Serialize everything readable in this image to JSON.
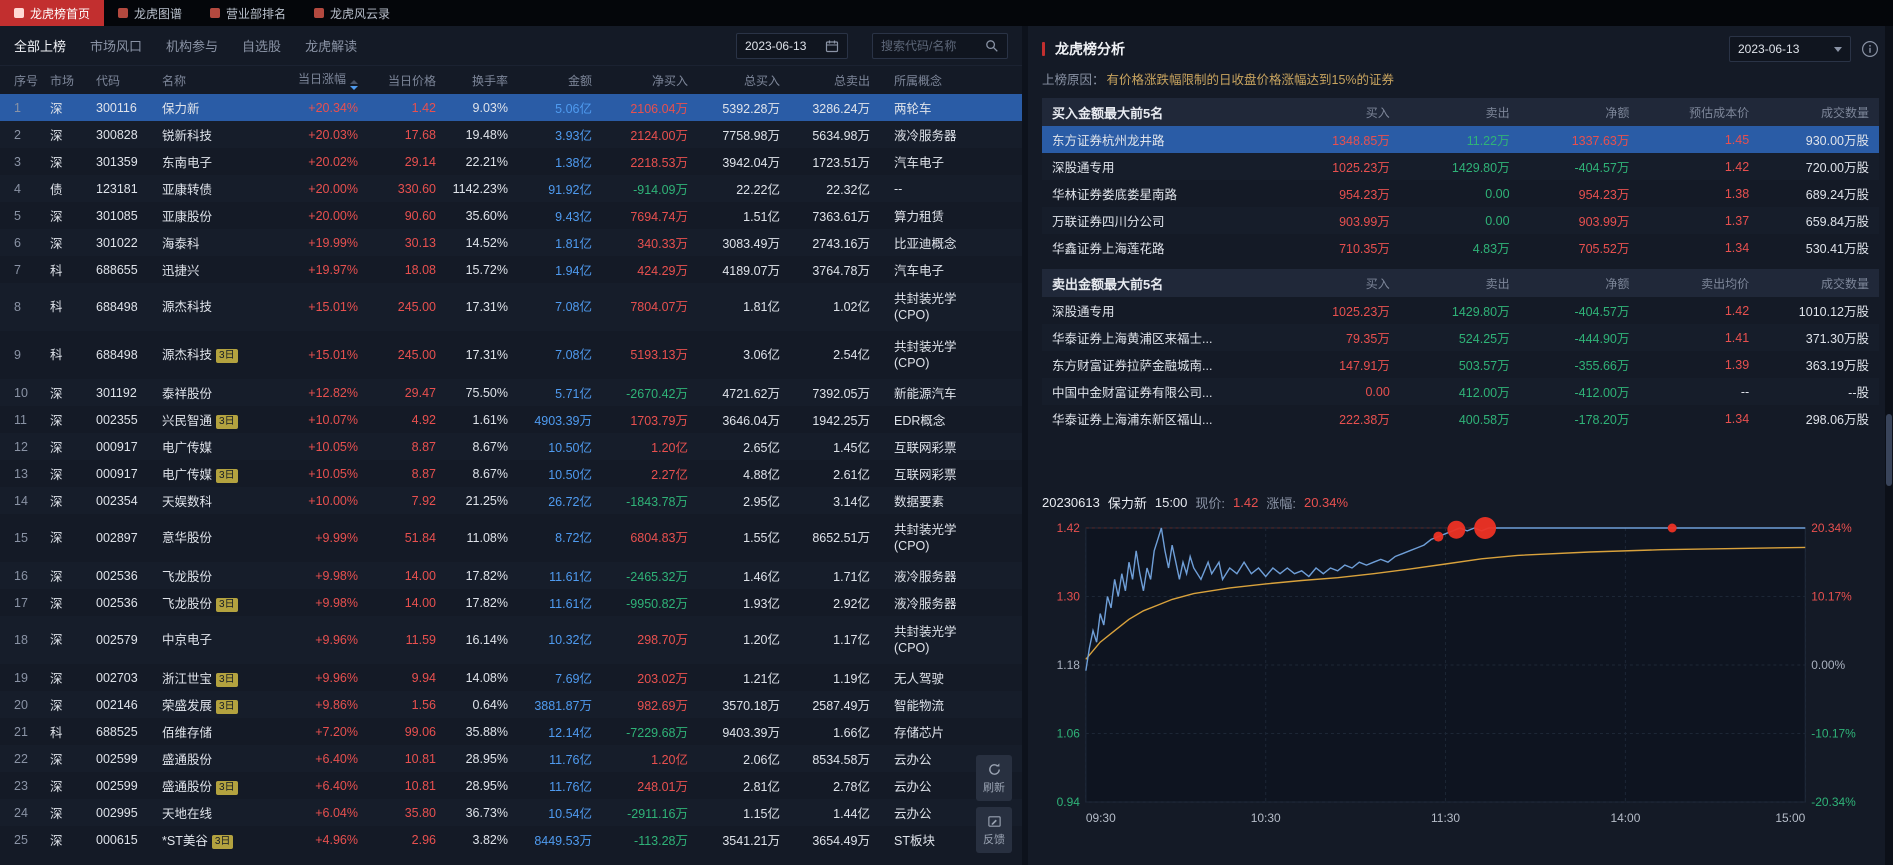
{
  "colors": {
    "accent": "#c22f2f",
    "up": "#e8504f",
    "down": "#2fb378",
    "blue": "#4f9bf0",
    "sel": "#2a5ca6",
    "badge": "#b3a23f",
    "reason": "#c8a45f",
    "price_line": "#6f9fd8",
    "avg_line": "#d9a23c",
    "marker": "#ee3124"
  },
  "topbar": {
    "tabs": [
      {
        "id": "home",
        "label": "龙虎榜首页",
        "active": true
      },
      {
        "id": "map",
        "label": "龙虎图谱",
        "active": false
      },
      {
        "id": "broker-rank",
        "label": "营业部排名",
        "active": false
      },
      {
        "id": "chronicle",
        "label": "龙虎风云录",
        "active": false
      }
    ]
  },
  "left": {
    "tabs": [
      {
        "id": "all",
        "label": "全部上榜",
        "active": true
      },
      {
        "id": "market-wind",
        "label": "市场风口",
        "active": false
      },
      {
        "id": "institution",
        "label": "机构参与",
        "active": false
      },
      {
        "id": "watchlist",
        "label": "自选股",
        "active": false
      },
      {
        "id": "interpretation",
        "label": "龙虎解读",
        "active": false
      }
    ],
    "date": "2023-06-13",
    "search_placeholder": "搜索代码/名称",
    "refresh_label": "刷新",
    "feedback_label": "反馈",
    "columns": [
      "序号",
      "市场",
      "代码",
      "名称",
      "当日涨幅",
      "当日价格",
      "换手率",
      "金额",
      "净买入",
      "总买入",
      "总卖出",
      "所属概念"
    ],
    "rows": [
      {
        "seq": "1",
        "market": "深",
        "code": "300116",
        "name": "保力新",
        "chg": "+20.34%",
        "price": "1.42",
        "to": "9.03%",
        "amt": "5.06亿",
        "net": "2106.04万",
        "tbuy": "5392.28万",
        "tsell": "3286.24万",
        "concept": [
          "两轮车"
        ],
        "sel": true
      },
      {
        "seq": "2",
        "market": "深",
        "code": "300828",
        "name": "锐新科技",
        "chg": "+20.03%",
        "price": "17.68",
        "to": "19.48%",
        "amt": "3.93亿",
        "net": "2124.00万",
        "tbuy": "7758.98万",
        "tsell": "5634.98万",
        "concept": [
          "液冷服务器"
        ]
      },
      {
        "seq": "3",
        "market": "深",
        "code": "301359",
        "name": "东南电子",
        "chg": "+20.02%",
        "price": "29.14",
        "to": "22.21%",
        "amt": "1.38亿",
        "net": "2218.53万",
        "tbuy": "3942.04万",
        "tsell": "1723.51万",
        "concept": [
          "汽车电子"
        ]
      },
      {
        "seq": "4",
        "market": "债",
        "code": "123181",
        "name": "亚康转债",
        "chg": "+20.00%",
        "price": "330.60",
        "to": "1142.23%",
        "amt": "91.92亿",
        "net": "-914.09万",
        "tbuy": "22.22亿",
        "tsell": "22.32亿",
        "concept": [
          "--"
        ]
      },
      {
        "seq": "5",
        "market": "深",
        "code": "301085",
        "name": "亚康股份",
        "chg": "+20.00%",
        "price": "90.60",
        "to": "35.60%",
        "amt": "9.43亿",
        "net": "7694.74万",
        "tbuy": "1.51亿",
        "tsell": "7363.61万",
        "concept": [
          "算力租赁"
        ]
      },
      {
        "seq": "6",
        "market": "深",
        "code": "301022",
        "name": "海泰科",
        "chg": "+19.99%",
        "price": "30.13",
        "to": "14.52%",
        "amt": "1.81亿",
        "net": "340.33万",
        "tbuy": "3083.49万",
        "tsell": "2743.16万",
        "concept": [
          "比亚迪概念"
        ]
      },
      {
        "seq": "7",
        "market": "科",
        "code": "688655",
        "name": "迅捷兴",
        "chg": "+19.97%",
        "price": "18.08",
        "to": "15.72%",
        "amt": "1.94亿",
        "net": "424.29万",
        "tbuy": "4189.07万",
        "tsell": "3764.78万",
        "concept": [
          "汽车电子"
        ]
      },
      {
        "seq": "8",
        "market": "科",
        "code": "688498",
        "name": "源杰科技",
        "chg": "+15.01%",
        "price": "245.00",
        "to": "17.31%",
        "amt": "7.08亿",
        "net": "7804.07万",
        "tbuy": "1.81亿",
        "tsell": "1.02亿",
        "concept": [
          "共封装光学",
          "(CPO)"
        ]
      },
      {
        "seq": "9",
        "market": "科",
        "code": "688498",
        "name": "源杰科技",
        "badge": "3日",
        "chg": "+15.01%",
        "price": "245.00",
        "to": "17.31%",
        "amt": "7.08亿",
        "net": "5193.13万",
        "tbuy": "3.06亿",
        "tsell": "2.54亿",
        "concept": [
          "共封装光学",
          "(CPO)"
        ]
      },
      {
        "seq": "10",
        "market": "深",
        "code": "301192",
        "name": "泰祥股份",
        "chg": "+12.82%",
        "price": "29.47",
        "to": "75.50%",
        "amt": "5.71亿",
        "net": "-2670.42万",
        "tbuy": "4721.62万",
        "tsell": "7392.05万",
        "concept": [
          "新能源汽车"
        ]
      },
      {
        "seq": "11",
        "market": "深",
        "code": "002355",
        "name": "兴民智通",
        "badge": "3日",
        "chg": "+10.07%",
        "price": "4.92",
        "to": "1.61%",
        "amt": "4903.39万",
        "net": "1703.79万",
        "tbuy": "3646.04万",
        "tsell": "1942.25万",
        "concept": [
          "EDR概念"
        ]
      },
      {
        "seq": "12",
        "market": "深",
        "code": "000917",
        "name": "电广传媒",
        "chg": "+10.05%",
        "price": "8.87",
        "to": "8.67%",
        "amt": "10.50亿",
        "net": "1.20亿",
        "tbuy": "2.65亿",
        "tsell": "1.45亿",
        "concept": [
          "互联网彩票"
        ]
      },
      {
        "seq": "13",
        "market": "深",
        "code": "000917",
        "name": "电广传媒",
        "badge": "3日",
        "chg": "+10.05%",
        "price": "8.87",
        "to": "8.67%",
        "amt": "10.50亿",
        "net": "2.27亿",
        "tbuy": "4.88亿",
        "tsell": "2.61亿",
        "concept": [
          "互联网彩票"
        ]
      },
      {
        "seq": "14",
        "market": "深",
        "code": "002354",
        "name": "天娱数科",
        "chg": "+10.00%",
        "price": "7.92",
        "to": "21.25%",
        "amt": "26.72亿",
        "net": "-1843.78万",
        "tbuy": "2.95亿",
        "tsell": "3.14亿",
        "concept": [
          "数据要素"
        ]
      },
      {
        "seq": "15",
        "market": "深",
        "code": "002897",
        "name": "意华股份",
        "chg": "+9.99%",
        "price": "51.84",
        "to": "11.08%",
        "amt": "8.72亿",
        "net": "6804.83万",
        "tbuy": "1.55亿",
        "tsell": "8652.51万",
        "concept": [
          "共封装光学",
          "(CPO)"
        ]
      },
      {
        "seq": "16",
        "market": "深",
        "code": "002536",
        "name": "飞龙股份",
        "chg": "+9.98%",
        "price": "14.00",
        "to": "17.82%",
        "amt": "11.61亿",
        "net": "-2465.32万",
        "tbuy": "1.46亿",
        "tsell": "1.71亿",
        "concept": [
          "液冷服务器"
        ]
      },
      {
        "seq": "17",
        "market": "深",
        "code": "002536",
        "name": "飞龙股份",
        "badge": "3日",
        "chg": "+9.98%",
        "price": "14.00",
        "to": "17.82%",
        "amt": "11.61亿",
        "net": "-9950.82万",
        "tbuy": "1.93亿",
        "tsell": "2.92亿",
        "concept": [
          "液冷服务器"
        ]
      },
      {
        "seq": "18",
        "market": "深",
        "code": "002579",
        "name": "中京电子",
        "chg": "+9.96%",
        "price": "11.59",
        "to": "16.14%",
        "amt": "10.32亿",
        "net": "298.70万",
        "tbuy": "1.20亿",
        "tsell": "1.17亿",
        "concept": [
          "共封装光学",
          "(CPO)"
        ]
      },
      {
        "seq": "19",
        "market": "深",
        "code": "002703",
        "name": "浙江世宝",
        "badge": "3日",
        "chg": "+9.96%",
        "price": "9.94",
        "to": "14.08%",
        "amt": "7.69亿",
        "net": "203.02万",
        "tbuy": "1.21亿",
        "tsell": "1.19亿",
        "concept": [
          "无人驾驶"
        ]
      },
      {
        "seq": "20",
        "market": "深",
        "code": "002146",
        "name": "荣盛发展",
        "badge": "3日",
        "chg": "+9.86%",
        "price": "1.56",
        "to": "0.64%",
        "amt": "3881.87万",
        "net": "982.69万",
        "tbuy": "3570.18万",
        "tsell": "2587.49万",
        "concept": [
          "智能物流"
        ]
      },
      {
        "seq": "21",
        "market": "科",
        "code": "688525",
        "name": "佰维存储",
        "chg": "+7.20%",
        "price": "99.06",
        "to": "35.88%",
        "amt": "12.14亿",
        "net": "-7229.68万",
        "tbuy": "9403.39万",
        "tsell": "1.66亿",
        "concept": [
          "存储芯片"
        ]
      },
      {
        "seq": "22",
        "market": "深",
        "code": "002599",
        "name": "盛通股份",
        "chg": "+6.40%",
        "price": "10.81",
        "to": "28.95%",
        "amt": "11.76亿",
        "net": "1.20亿",
        "tbuy": "2.06亿",
        "tsell": "8534.58万",
        "concept": [
          "云办公"
        ]
      },
      {
        "seq": "23",
        "market": "深",
        "code": "002599",
        "name": "盛通股份",
        "badge": "3日",
        "chg": "+6.40%",
        "price": "10.81",
        "to": "28.95%",
        "amt": "11.76亿",
        "net": "248.01万",
        "tbuy": "2.81亿",
        "tsell": "2.78亿",
        "concept": [
          "云办公"
        ]
      },
      {
        "seq": "24",
        "market": "深",
        "code": "002995",
        "name": "天地在线",
        "chg": "+6.04%",
        "price": "35.80",
        "to": "36.73%",
        "amt": "10.54亿",
        "net": "-2911.16万",
        "tbuy": "1.15亿",
        "tsell": "1.44亿",
        "concept": [
          "云办公"
        ]
      },
      {
        "seq": "25",
        "market": "深",
        "code": "000615",
        "name": "*ST美谷",
        "badge": "3日",
        "chg": "+4.96%",
        "price": "2.96",
        "to": "3.82%",
        "amt": "8449.53万",
        "net": "-113.28万",
        "tbuy": "3541.21万",
        "tsell": "3654.49万",
        "concept": [
          "ST板块"
        ]
      }
    ]
  },
  "right": {
    "title": "龙虎榜分析",
    "date": "2023-06-13",
    "reason_label": "上榜原因：",
    "reason_text": "有价格涨跌幅限制的日收盘价格涨幅达到15%的证券",
    "buy_table": {
      "title": "买入金额最大前5名",
      "columns": [
        "买入",
        "卖出",
        "净额",
        "预估成本价",
        "成交数量"
      ],
      "rows": [
        {
          "name": "东方证券杭州龙井路",
          "buy": "1348.85万",
          "sell": "11.22万",
          "net": "1337.63万",
          "price": "1.45",
          "vol": "930.00万股",
          "selected": true
        },
        {
          "name": "深股通专用",
          "buy": "1025.23万",
          "sell": "1429.80万",
          "net": "-404.57万",
          "price": "1.42",
          "vol": "720.00万股"
        },
        {
          "name": "华林证券娄底娄星南路",
          "buy": "954.23万",
          "sell": "0.00",
          "net": "954.23万",
          "price": "1.38",
          "vol": "689.24万股"
        },
        {
          "name": "万联证券四川分公司",
          "buy": "903.99万",
          "sell": "0.00",
          "net": "903.99万",
          "price": "1.37",
          "vol": "659.84万股"
        },
        {
          "name": "华鑫证券上海莲花路",
          "buy": "710.35万",
          "sell": "4.83万",
          "net": "705.52万",
          "price": "1.34",
          "vol": "530.41万股"
        }
      ]
    },
    "sell_table": {
      "title": "卖出金额最大前5名",
      "columns": [
        "买入",
        "卖出",
        "净额",
        "卖出均价",
        "成交数量"
      ],
      "rows": [
        {
          "name": "深股通专用",
          "buy": "1025.23万",
          "sell": "1429.80万",
          "net": "-404.57万",
          "price": "1.42",
          "vol": "1010.12万股"
        },
        {
          "name": "华泰证券上海黄浦区来福士...",
          "buy": "79.35万",
          "sell": "524.25万",
          "net": "-444.90万",
          "price": "1.41",
          "vol": "371.30万股"
        },
        {
          "name": "东方财富证券拉萨金融城南...",
          "buy": "147.91万",
          "sell": "503.57万",
          "net": "-355.66万",
          "price": "1.39",
          "vol": "363.19万股"
        },
        {
          "name": "中国中金财富证券有限公司...",
          "buy": "0.00",
          "sell": "412.00万",
          "net": "-412.00万",
          "price": "--",
          "vol": "--股"
        },
        {
          "name": "华泰证券上海浦东新区福山...",
          "buy": "222.38万",
          "sell": "400.58万",
          "net": "-178.20万",
          "price": "1.34",
          "vol": "298.06万股"
        }
      ]
    },
    "chart_header": {
      "date": "20230613",
      "name": "保力新",
      "time": "15:00",
      "price_label": "现价:",
      "price": "1.42",
      "change_label": "涨幅:",
      "change": "20.34%"
    }
  },
  "chart_data": {
    "type": "line",
    "title": "20230613 保力新 15:00 现价: 1.42 涨幅: 20.34%",
    "symbol": "保力新",
    "date": "20230613",
    "current_price": 1.42,
    "change_pct": "20.34%",
    "prev_close": 1.18,
    "ylim": [
      0.94,
      1.42
    ],
    "y_ticks_price": [
      "1.42",
      "1.30",
      "1.18",
      "1.06",
      "0.94"
    ],
    "y_ticks_pct": [
      "20.34%",
      "10.17%",
      "0.00%",
      "-10.17%",
      "-20.34%"
    ],
    "x_ticks": [
      "09:30",
      "10:30",
      "11:30",
      "14:00",
      "15:00"
    ],
    "grid": true,
    "legend": "none",
    "price_series": [
      [
        0,
        1.17
      ],
      [
        0.005,
        1.21
      ],
      [
        0.01,
        1.24
      ],
      [
        0.015,
        1.22
      ],
      [
        0.02,
        1.27
      ],
      [
        0.025,
        1.25
      ],
      [
        0.03,
        1.3
      ],
      [
        0.035,
        1.28
      ],
      [
        0.04,
        1.33
      ],
      [
        0.045,
        1.3
      ],
      [
        0.05,
        1.34
      ],
      [
        0.055,
        1.31
      ],
      [
        0.06,
        1.36
      ],
      [
        0.065,
        1.33
      ],
      [
        0.07,
        1.38
      ],
      [
        0.075,
        1.34
      ],
      [
        0.08,
        1.31
      ],
      [
        0.085,
        1.35
      ],
      [
        0.09,
        1.33
      ],
      [
        0.095,
        1.38
      ],
      [
        0.1,
        1.4
      ],
      [
        0.105,
        1.42
      ],
      [
        0.11,
        1.38
      ],
      [
        0.115,
        1.35
      ],
      [
        0.12,
        1.39
      ],
      [
        0.125,
        1.36
      ],
      [
        0.13,
        1.33
      ],
      [
        0.135,
        1.36
      ],
      [
        0.14,
        1.34
      ],
      [
        0.145,
        1.37
      ],
      [
        0.15,
        1.35
      ],
      [
        0.16,
        1.33
      ],
      [
        0.17,
        1.36
      ],
      [
        0.175,
        1.34
      ],
      [
        0.185,
        1.36
      ],
      [
        0.19,
        1.33
      ],
      [
        0.2,
        1.35
      ],
      [
        0.21,
        1.34
      ],
      [
        0.22,
        1.36
      ],
      [
        0.23,
        1.34
      ],
      [
        0.24,
        1.35
      ],
      [
        0.25,
        1.335
      ],
      [
        0.26,
        1.35
      ],
      [
        0.27,
        1.34
      ],
      [
        0.28,
        1.35
      ],
      [
        0.29,
        1.34
      ],
      [
        0.3,
        1.345
      ],
      [
        0.31,
        1.335
      ],
      [
        0.32,
        1.35
      ],
      [
        0.33,
        1.34
      ],
      [
        0.34,
        1.35
      ],
      [
        0.35,
        1.345
      ],
      [
        0.36,
        1.355
      ],
      [
        0.37,
        1.35
      ],
      [
        0.38,
        1.36
      ],
      [
        0.39,
        1.355
      ],
      [
        0.4,
        1.36
      ],
      [
        0.41,
        1.365
      ],
      [
        0.42,
        1.36
      ],
      [
        0.43,
        1.37
      ],
      [
        0.44,
        1.375
      ],
      [
        0.45,
        1.38
      ],
      [
        0.46,
        1.385
      ],
      [
        0.47,
        1.39
      ],
      [
        0.48,
        1.4
      ],
      [
        0.49,
        1.405
      ],
      [
        0.5,
        1.41
      ],
      [
        0.51,
        1.415
      ],
      [
        0.52,
        1.42
      ],
      [
        0.53,
        1.415
      ],
      [
        0.54,
        1.42
      ],
      [
        0.55,
        1.415
      ],
      [
        0.56,
        1.42
      ],
      [
        0.6,
        1.42
      ],
      [
        0.7,
        1.42
      ],
      [
        0.8,
        1.42
      ],
      [
        0.9,
        1.42
      ],
      [
        1,
        1.42
      ]
    ],
    "avg_series": [
      [
        0,
        1.19
      ],
      [
        0.02,
        1.22
      ],
      [
        0.04,
        1.24
      ],
      [
        0.06,
        1.26
      ],
      [
        0.08,
        1.275
      ],
      [
        0.1,
        1.285
      ],
      [
        0.12,
        1.295
      ],
      [
        0.15,
        1.305
      ],
      [
        0.2,
        1.315
      ],
      [
        0.25,
        1.322
      ],
      [
        0.3,
        1.328
      ],
      [
        0.35,
        1.333
      ],
      [
        0.4,
        1.34
      ],
      [
        0.45,
        1.348
      ],
      [
        0.5,
        1.357
      ],
      [
        0.55,
        1.366
      ],
      [
        0.6,
        1.372
      ],
      [
        0.7,
        1.378
      ],
      [
        0.8,
        1.382
      ],
      [
        0.9,
        1.384
      ],
      [
        1,
        1.386
      ]
    ],
    "markers": [
      {
        "x": 0.49,
        "y": 1.405,
        "r": 5
      },
      {
        "x": 0.515,
        "y": 1.417,
        "r": 9
      },
      {
        "x": 0.555,
        "y": 1.42,
        "r": 11
      },
      {
        "x": 0.815,
        "y": 1.42,
        "r": 4.5
      }
    ],
    "limit_line": 1.42
  }
}
